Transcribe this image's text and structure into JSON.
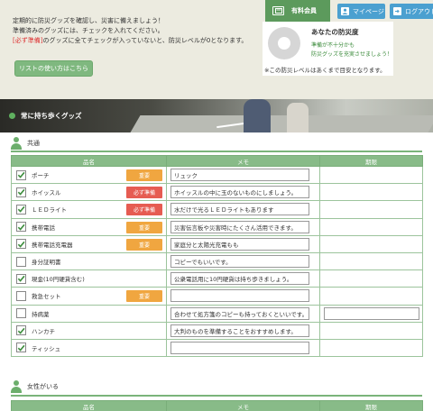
{
  "intro": {
    "line1": "定期的に防災グッズを確認し、災害に備えましょう！",
    "line2": "準備済みのグッズには、チェックを入れてください。",
    "line3_req": "[必ず準備]",
    "line3_rest": "のグッズに全てチェックが入っていないと、防災レベルが0となります。",
    "howto_button": "リストの使い方はこちら"
  },
  "header": {
    "member_label": "有料会員",
    "mypage_label": "マイページ",
    "logout_label": "ログアウト"
  },
  "prevention": {
    "title": "あなたの防災度",
    "message_line1": "準備が不十分かも",
    "message_line2": "防災グッズを充実させましょう！",
    "note": "※この防災レベルはあくまで目安となります。",
    "level": 0
  },
  "banner": {
    "title": "常に持ち歩くグッズ"
  },
  "sections": [
    {
      "title": "共通",
      "columns": [
        "品名",
        "メモ",
        "期限"
      ],
      "rows": [
        {
          "checked": true,
          "name": "ポーチ",
          "tag": "重要",
          "tag_type": "rec",
          "memo": "リュック"
        },
        {
          "checked": true,
          "name": "ホイッスル",
          "tag": "必ず準備",
          "tag_type": "must",
          "memo": "ホイッスルの中に玉のないものにしましょう。"
        },
        {
          "checked": true,
          "name": "ＬＥＤライト",
          "tag": "必ず準備",
          "tag_type": "must",
          "memo": "水だけで光るＬＥＤライトもあります"
        },
        {
          "checked": true,
          "name": "携帯電話",
          "tag": "重要",
          "tag_type": "rec",
          "memo": "災害伝言板や災害時にたくさん活用できます。"
        },
        {
          "checked": true,
          "name": "携帯電話充電器",
          "tag": "重要",
          "tag_type": "rec",
          "memo": "家庭分と太陽光充電もも"
        },
        {
          "checked": false,
          "name": "身分証明書",
          "tag": "",
          "tag_type": "",
          "memo": "コピーでもいいです。"
        },
        {
          "checked": true,
          "name": "現金(10円硬貨含む)",
          "tag": "",
          "tag_type": "",
          "memo": "公衆電話用に10円硬貨は持ち歩きましょう。"
        },
        {
          "checked": false,
          "name": "救急セット",
          "tag": "重要",
          "tag_type": "rec",
          "memo": ""
        },
        {
          "checked": false,
          "name": "持病薬",
          "tag": "",
          "tag_type": "",
          "memo": "合わせて処方箋のコピーも持っておくといいです。"
        },
        {
          "checked": true,
          "name": "ハンカチ",
          "tag": "",
          "tag_type": "",
          "memo": "大判のものを準備することをおすすめします。"
        },
        {
          "checked": true,
          "name": "ティッシュ",
          "tag": "",
          "tag_type": "",
          "memo": ""
        }
      ]
    },
    {
      "title": "女性がいる",
      "columns": [
        "品名",
        "メモ",
        "期限"
      ],
      "rows": []
    }
  ]
}
